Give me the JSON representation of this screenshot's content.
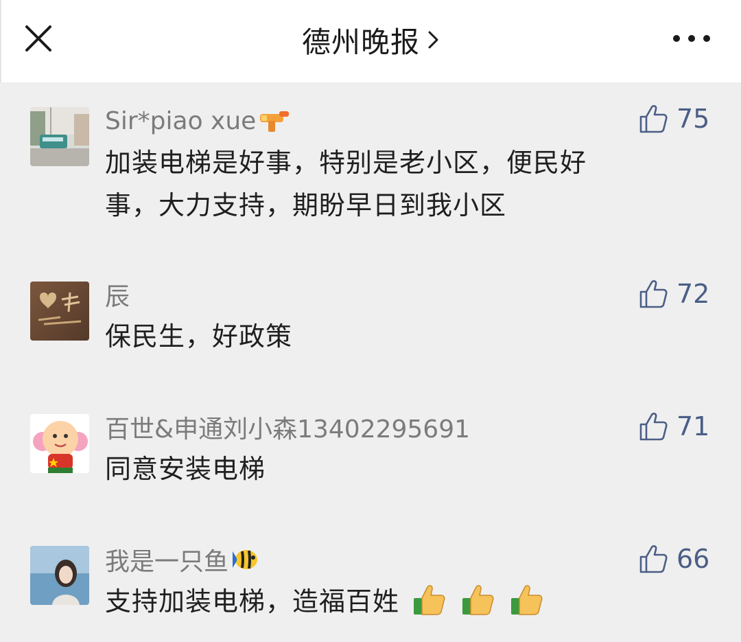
{
  "header": {
    "title": "德州晚报",
    "close_icon": "close-icon",
    "chevron_icon": "chevron-right-icon",
    "more_icon": "more-dots-icon"
  },
  "comments": [
    {
      "nickname": "Sir*piao xue",
      "nick_emoji": "water-gun-emoji",
      "text_line1": "加装电梯是好事，特别是老小区，便民好",
      "text_line2": "事，大力支持，期盼早日到我小区",
      "likes": "75"
    },
    {
      "nickname": "辰",
      "text_line1": "保民生，好政策",
      "likes": "72"
    },
    {
      "nickname": "百世&申通刘小森13402295691",
      "text_line1": "同意安装电梯",
      "likes": "71"
    },
    {
      "nickname": "我是一只鱼",
      "nick_emoji": "tropical-fish-emoji",
      "text_line1": "支持加装电梯，造福百姓",
      "text_emoji": "thumbs-up-emoji",
      "likes": "66"
    }
  ],
  "colors": {
    "background": "#efefef",
    "header_bg": "#ffffff",
    "nickname": "#7b7b7b",
    "like_accent": "#4a5e86"
  }
}
